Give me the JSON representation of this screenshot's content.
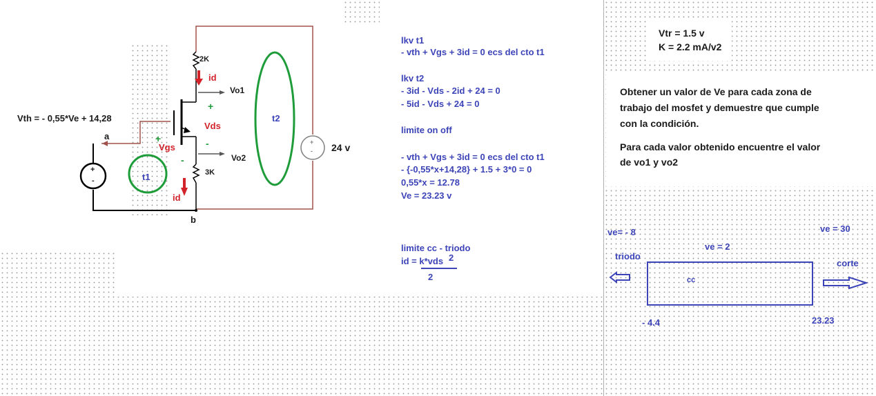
{
  "circuit": {
    "vth_equation": "Vth = - 0,55*Ve + 14,28",
    "node_a": "a",
    "node_b": "b",
    "r_top": "2K",
    "r_bottom": "3K",
    "id_top": "id",
    "id_bottom": "id",
    "vo1": "Vo1",
    "vo2": "Vo2",
    "vds": "Vds",
    "vgs": "Vgs",
    "plus_drain": "+",
    "minus_source": "-",
    "plus_gate": "+",
    "minus_gate": "-",
    "loop_t1": "t1",
    "loop_t2": "t2",
    "supply": "24 v",
    "source_plus": "+",
    "source_minus": "-"
  },
  "equations": {
    "lkv_t1_title": "lkv t1",
    "lkv_t1_eq": "- vth + Vgs + 3id = 0  ecs del cto t1",
    "lkv_t2_title": "lkv t2",
    "lkv_t2_eq1": "- 3id - Vds - 2id + 24 = 0",
    "lkv_t2_eq2": "- 5id - Vds + 24 = 0",
    "onoff_title": "limite on off",
    "onoff_eq1": "- vth + Vgs + 3id = 0  ecs del cto t1",
    "onoff_eq2": "- {-0,55*x+14,28} + 1.5 + 3*0 = 0",
    "onoff_eq3": "0,55*x   = 12.78",
    "onoff_eq4": "Ve   = 23.23 v",
    "cc_title": "limite cc - triodo",
    "cc_formula_main": "id = k*vds",
    "cc_formula_exp": "2",
    "cc_formula_den": "2"
  },
  "params": {
    "vtr": "Vtr = 1.5  v",
    "k": "K = 2.2 mA/v2"
  },
  "problem": {
    "line1": "Obtener un valor de Ve para cada zona de",
    "line2": "trabajo del mosfet y demuestre que cumple",
    "line3": "con la condición.",
    "line4": "Para cada valor obtenido encuentre el valor",
    "line5": "de vo1 y vo2"
  },
  "zones": {
    "ve_neg8": "ve= - 8",
    "ve_2": "ve = 2",
    "ve_30": "ve = 30",
    "triodo": "triodo",
    "corte": "corte",
    "cc": "cc",
    "bound_low": "- 4.4",
    "bound_high": "23.23"
  },
  "colors": {
    "blue_text": "#3c44b8",
    "red": "#d2232a",
    "green": "#1e9c3a",
    "wire_brown": "#a0524a",
    "wire_black": "#000000"
  }
}
